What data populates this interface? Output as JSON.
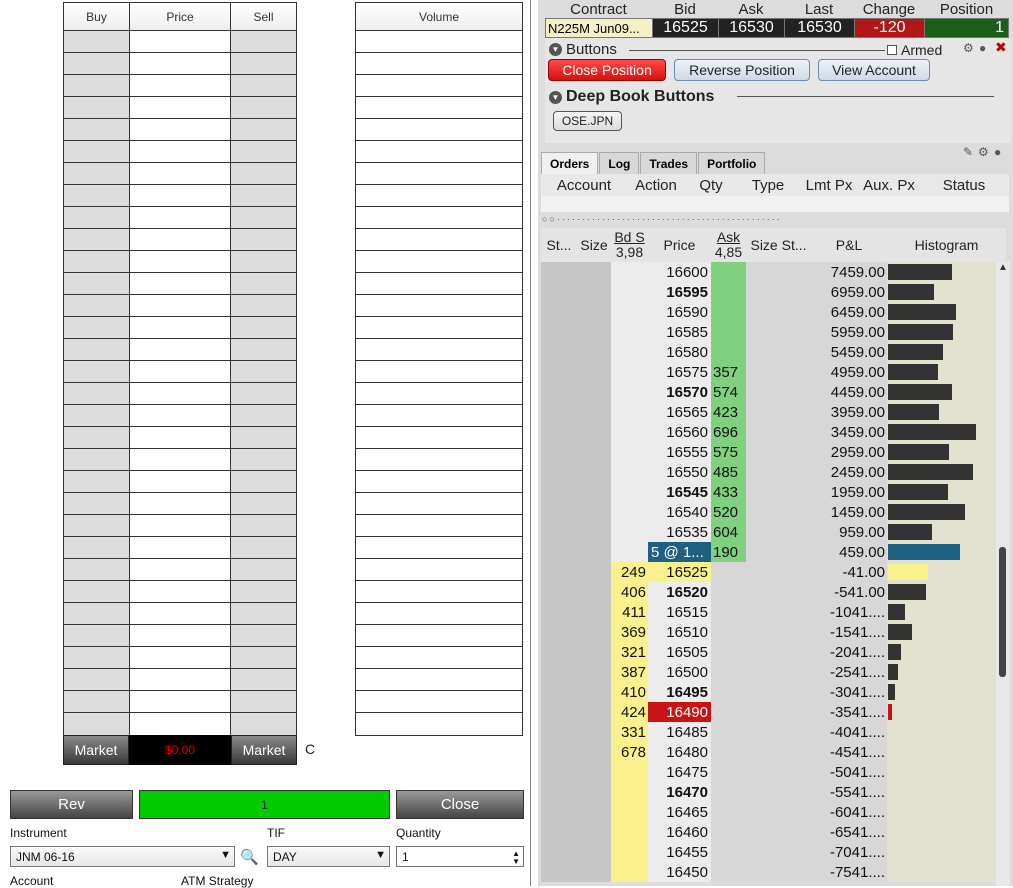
{
  "ladder": {
    "headers": {
      "buy": "Buy",
      "price": "Price",
      "sell": "Sell",
      "volume": "Volume"
    },
    "market_label": "Market",
    "market_price": "$0.00",
    "c_glyph": "C"
  },
  "order_entry": {
    "rev": "Rev",
    "quantity_display": "1",
    "close": "Close",
    "instrument_label": "Instrument",
    "tif_label": "TIF",
    "quantity_label": "Quantity",
    "instrument_value": "JNM 06-16",
    "tif_value": "DAY",
    "quantity_value": "1",
    "account_label": "Account",
    "atm_label": "ATM Strategy"
  },
  "quote": {
    "headers": [
      "Contract",
      "Bid",
      "Ask",
      "Last",
      "Change",
      "Position"
    ],
    "contract": "N225M Jun09...",
    "bid": "16525",
    "ask": "16530",
    "last": "16530",
    "change": "-120",
    "position": "1"
  },
  "buttons_panel": {
    "title": "Buttons",
    "armed": "Armed",
    "close_position": "Close Position",
    "reverse_position": "Reverse Position",
    "view_account": "View Account",
    "deep_book_title": "Deep Book Buttons",
    "ose": "OSE.JPN"
  },
  "tabs": [
    "Orders",
    "Log",
    "Trades",
    "Portfolio"
  ],
  "orders_headers": [
    "Account",
    "Action",
    "Qty",
    "Type",
    "Lmt Px",
    "Aux. Px",
    "Status"
  ],
  "deep_book": {
    "headers": {
      "st": "St...",
      "size": "Size",
      "bd": "Bd S",
      "bd_sub": "3,98",
      "price": "Price",
      "ask": "Ask",
      "ask_sub": "4,85",
      "size_st": "Size St...",
      "pnl": "P&L",
      "hist": "Histogram"
    },
    "rows": [
      {
        "bid": "",
        "price": "16600",
        "ask": "",
        "pnl": "7459.00",
        "h": 0.59,
        "bold": false
      },
      {
        "bid": "",
        "price": "16595",
        "ask": "",
        "pnl": "6959.00",
        "h": 0.42,
        "bold": true
      },
      {
        "bid": "",
        "price": "16590",
        "ask": "",
        "pnl": "6459.00",
        "h": 0.62,
        "bold": false
      },
      {
        "bid": "",
        "price": "16585",
        "ask": "",
        "pnl": "5959.00",
        "h": 0.6,
        "bold": false
      },
      {
        "bid": "",
        "price": "16580",
        "ask": "",
        "pnl": "5459.00",
        "h": 0.5,
        "bold": false
      },
      {
        "bid": "",
        "price": "16575",
        "ask": "357",
        "pnl": "4959.00",
        "h": 0.46,
        "bold": false
      },
      {
        "bid": "",
        "price": "16570",
        "ask": "574",
        "pnl": "4459.00",
        "h": 0.59,
        "bold": true
      },
      {
        "bid": "",
        "price": "16565",
        "ask": "423",
        "pnl": "3959.00",
        "h": 0.47,
        "bold": false
      },
      {
        "bid": "",
        "price": "16560",
        "ask": "696",
        "pnl": "3459.00",
        "h": 0.81,
        "bold": false
      },
      {
        "bid": "",
        "price": "16555",
        "ask": "575",
        "pnl": "2959.00",
        "h": 0.56,
        "bold": false
      },
      {
        "bid": "",
        "price": "16550",
        "ask": "485",
        "pnl": "2459.00",
        "h": 0.78,
        "bold": false
      },
      {
        "bid": "",
        "price": "16545",
        "ask": "433",
        "pnl": "1959.00",
        "h": 0.55,
        "bold": true
      },
      {
        "bid": "",
        "price": "16540",
        "ask": "520",
        "pnl": "1459.00",
        "h": 0.71,
        "bold": false
      },
      {
        "bid": "",
        "price": "16535",
        "ask": "604",
        "pnl": "959.00",
        "h": 0.4,
        "bold": false
      },
      {
        "bid": "",
        "price": "5 @ 1...",
        "ask": "190",
        "pnl": "459.00",
        "h": 0.66,
        "bold": false,
        "pos": true
      },
      {
        "bid": "249",
        "price": "16525",
        "ask": "",
        "pnl": "-41.00",
        "h": 0.37,
        "bold": false,
        "yellow": true
      },
      {
        "bid": "406",
        "price": "16520",
        "ask": "",
        "pnl": "-541.00",
        "h": 0.35,
        "bold": true
      },
      {
        "bid": "411",
        "price": "16515",
        "ask": "",
        "pnl": "-1041....",
        "h": 0.16,
        "bold": false
      },
      {
        "bid": "369",
        "price": "16510",
        "ask": "",
        "pnl": "-1541....",
        "h": 0.22,
        "bold": false
      },
      {
        "bid": "321",
        "price": "16505",
        "ask": "",
        "pnl": "-2041....",
        "h": 0.12,
        "bold": false
      },
      {
        "bid": "387",
        "price": "16500",
        "ask": "",
        "pnl": "-2541....",
        "h": 0.09,
        "bold": false
      },
      {
        "bid": "410",
        "price": "16495",
        "ask": "",
        "pnl": "-3041....",
        "h": 0.06,
        "bold": true
      },
      {
        "bid": "424",
        "price": "16490",
        "ask": "",
        "pnl": "-3541....",
        "h": 0.04,
        "bold": false,
        "last": true
      },
      {
        "bid": "331",
        "price": "16485",
        "ask": "",
        "pnl": "-4041....",
        "h": 0,
        "bold": false
      },
      {
        "bid": "678",
        "price": "16480",
        "ask": "",
        "pnl": "-4541....",
        "h": 0,
        "bold": false
      },
      {
        "bid": "",
        "price": "16475",
        "ask": "",
        "pnl": "-5041....",
        "h": 0,
        "bold": false
      },
      {
        "bid": "",
        "price": "16470",
        "ask": "",
        "pnl": "-5541....",
        "h": 0,
        "bold": true
      },
      {
        "bid": "",
        "price": "16465",
        "ask": "",
        "pnl": "-6041....",
        "h": 0,
        "bold": false
      },
      {
        "bid": "",
        "price": "16460",
        "ask": "",
        "pnl": "-6541....",
        "h": 0,
        "bold": false
      },
      {
        "bid": "",
        "price": "16455",
        "ask": "",
        "pnl": "-7041....",
        "h": 0,
        "bold": false
      },
      {
        "bid": "",
        "price": "16450",
        "ask": "",
        "pnl": "-7541....",
        "h": 0,
        "bold": false
      }
    ]
  },
  "colors": {
    "ask_green": "#7fd07f",
    "bid_yellow": "#faf08c",
    "last_red": "#c81414",
    "position_blue": "#1e5f82",
    "hist_dark": "#333333",
    "change_bg": "#b01818",
    "close_red": "#e02020"
  }
}
